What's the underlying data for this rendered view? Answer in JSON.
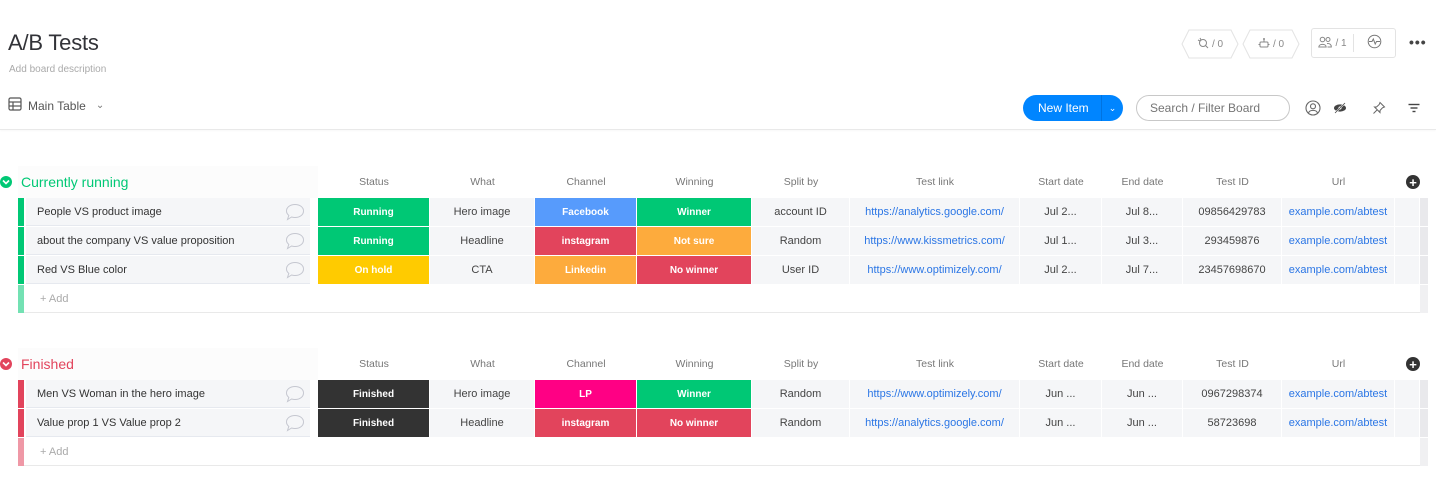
{
  "board": {
    "title": "A/B Tests",
    "description": "Add board description",
    "view_label": "Main Table"
  },
  "topbar": {
    "integrations_count": "/ 0",
    "automations_count": "/ 0",
    "members_count": "/ 1",
    "more_label": "•••"
  },
  "toolbar": {
    "new_item_label": "New Item",
    "search_placeholder": "Search / Filter Board"
  },
  "columns": [
    "Status",
    "What",
    "Channel",
    "Winning",
    "Split by",
    "Test link",
    "Start date",
    "End date",
    "Test ID",
    "Url"
  ],
  "colors": {
    "running_group": "#00c875",
    "finished_group": "#e2445c",
    "status_running": "#00c875",
    "status_on_hold": "#ffcb00",
    "status_finished": "#333333",
    "channel_facebook": "#579bfc",
    "channel_instagram": "#e2445c",
    "channel_linkedin": "#fdab3d",
    "channel_lp": "#ff0084",
    "winning_winner": "#00c875",
    "winning_not_sure": "#fdab3d",
    "winning_no_winner": "#e2445c",
    "link": "#2b76e5",
    "primary": "#0085ff"
  },
  "groups": [
    {
      "title": "Currently running",
      "color": "#00c875",
      "add_label": "+ Add",
      "rows": [
        {
          "name": "People VS product image",
          "status": "Running",
          "status_color": "#00c875",
          "what": "Hero image",
          "channel": "Facebook",
          "channel_color": "#579bfc",
          "winning": "Winner",
          "winning_color": "#00c875",
          "split_by": "account ID",
          "test_link": "https://analytics.google.com/",
          "start_date": "Jul 2...",
          "end_date": "Jul 8...",
          "test_id": "09856429783",
          "url": "example.com/abtest"
        },
        {
          "name": "about the company VS value proposition",
          "status": "Running",
          "status_color": "#00c875",
          "what": "Headline",
          "channel": "instagram",
          "channel_color": "#e2445c",
          "winning": "Not sure",
          "winning_color": "#fdab3d",
          "split_by": "Random",
          "test_link": "https://www.kissmetrics.com/",
          "start_date": "Jul 1...",
          "end_date": "Jul 3...",
          "test_id": "293459876",
          "url": "example.com/abtest"
        },
        {
          "name": "Red VS Blue color",
          "status": "On hold",
          "status_color": "#ffcb00",
          "what": "CTA",
          "channel": "Linkedin",
          "channel_color": "#fdab3d",
          "winning": "No winner",
          "winning_color": "#e2445c",
          "split_by": "User ID",
          "test_link": "https://www.optimizely.com/",
          "start_date": "Jul 2...",
          "end_date": "Jul 7...",
          "test_id": "23457698670",
          "url": "example.com/abtest"
        }
      ]
    },
    {
      "title": "Finished",
      "color": "#e2445c",
      "add_label": "+ Add",
      "rows": [
        {
          "name": "Men VS Woman in the hero image",
          "status": "Finished",
          "status_color": "#333333",
          "what": "Hero image",
          "channel": "LP",
          "channel_color": "#ff0084",
          "winning": "Winner",
          "winning_color": "#00c875",
          "split_by": "Random",
          "test_link": "https://www.optimizely.com/",
          "start_date": "Jun ...",
          "end_date": "Jun ...",
          "test_id": "0967298374",
          "url": "example.com/abtest"
        },
        {
          "name": "Value prop 1 VS Value prop 2",
          "status": "Finished",
          "status_color": "#333333",
          "what": "Headline",
          "channel": "instagram",
          "channel_color": "#e2445c",
          "winning": "No winner",
          "winning_color": "#e2445c",
          "split_by": "Random",
          "test_link": "https://analytics.google.com/",
          "start_date": "Jun ...",
          "end_date": "Jun ...",
          "test_id": "58723698",
          "url": "example.com/abtest"
        }
      ]
    }
  ]
}
